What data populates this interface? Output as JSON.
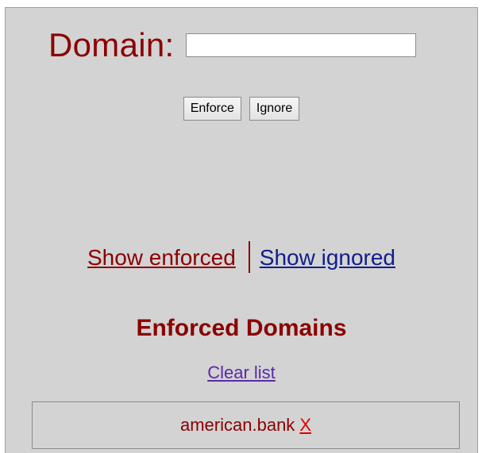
{
  "form": {
    "label": "Domain:",
    "input_value": "",
    "input_placeholder": "",
    "enforce_label": "Enforce",
    "ignore_label": "Ignore"
  },
  "nav": {
    "show_enforced": "Show enforced",
    "show_ignored": "Show ignored"
  },
  "section": {
    "title": "Enforced Domains",
    "clear_label": "Clear list"
  },
  "domains": [
    {
      "name": "american.bank",
      "remove_label": "X"
    }
  ],
  "colors": {
    "panel_background": "#d3d3d3",
    "accent": "#8b0000",
    "link_ignored": "#0f1e8c",
    "link_visited": "#5a2aa6",
    "remove": "#e00000"
  }
}
